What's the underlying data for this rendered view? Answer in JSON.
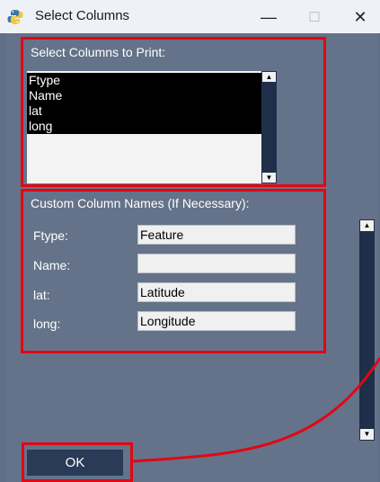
{
  "window": {
    "title": "Select Columns",
    "controls": {
      "minimize": "—",
      "maximize": "☐",
      "close": "✕"
    }
  },
  "columns_section": {
    "label": "Select Columns to Print:",
    "items": [
      "Ftype",
      "Name",
      "lat",
      "long"
    ]
  },
  "custom_names_section": {
    "label": "Custom Column Names (If Necessary):",
    "fields": [
      {
        "label": "Ftype:",
        "value": "Feature"
      },
      {
        "label": "Name:",
        "value": ""
      },
      {
        "label": "lat:",
        "value": "Latitude"
      },
      {
        "label": "long:",
        "value": "Longitude"
      }
    ]
  },
  "ok_button": {
    "label": "OK"
  },
  "colors": {
    "background": "#647389",
    "titlebar": "#eef1f6",
    "selection": "#000000",
    "button": "#2a3b58",
    "scrollbar": "#1f2f4a",
    "annotation": "#e30613"
  },
  "icons": {
    "app": "python-icon",
    "scroll_up": "triangle-up-icon",
    "scroll_down": "triangle-down-icon"
  }
}
